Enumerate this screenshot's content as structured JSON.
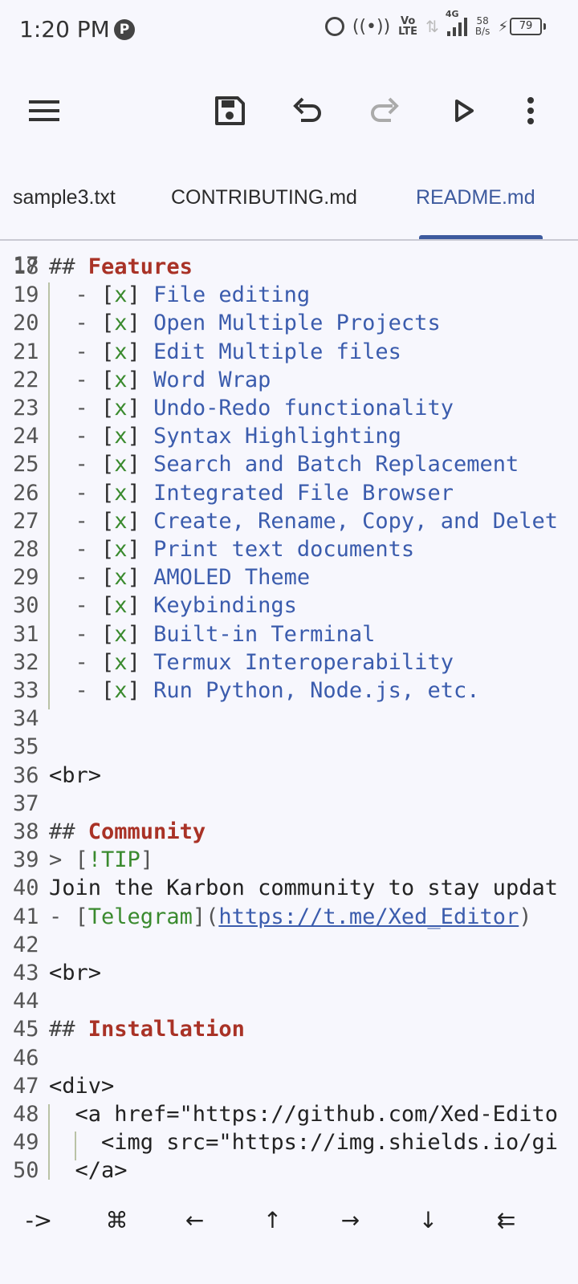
{
  "status": {
    "time": "1:20 PM",
    "p_badge": "P",
    "volte_top": "Vo",
    "volte_bottom": "LTE",
    "net_type": "4G",
    "speed_value": "58",
    "speed_unit": "B/s",
    "battery": "79",
    "icons": [
      "alarm-icon",
      "hotspot-icon",
      "volte-icon",
      "data-arrows-icon",
      "signal-icon",
      "charging-icon",
      "battery-icon"
    ]
  },
  "toolbar": {
    "icons": [
      "menu-icon",
      "save-icon",
      "undo-icon",
      "redo-icon",
      "run-icon",
      "more-icon"
    ]
  },
  "tabs": [
    {
      "label": "sample3.txt",
      "active": false
    },
    {
      "label": "CONTRIBUTING.md",
      "active": false
    },
    {
      "label": "README.md",
      "active": true
    }
  ],
  "editor": {
    "partial_top_line": "17",
    "lines": [
      {
        "n": "18",
        "hash": "##",
        "heading": "Features"
      },
      {
        "n": "19",
        "dash": "-",
        "box": "[x]",
        "text": "File editing"
      },
      {
        "n": "20",
        "dash": "-",
        "box": "[x]",
        "text": "Open Multiple Projects"
      },
      {
        "n": "21",
        "dash": "-",
        "box": "[x]",
        "text": "Edit Multiple files"
      },
      {
        "n": "22",
        "dash": "-",
        "box": "[x]",
        "text": "Word Wrap"
      },
      {
        "n": "23",
        "dash": "-",
        "box": "[x]",
        "text": "Undo-Redo functionality"
      },
      {
        "n": "24",
        "dash": "-",
        "box": "[x]",
        "text": "Syntax Highlighting"
      },
      {
        "n": "25",
        "dash": "-",
        "box": "[x]",
        "text": "Search and Batch Replacement"
      },
      {
        "n": "26",
        "dash": "-",
        "box": "[x]",
        "text": "Integrated File Browser"
      },
      {
        "n": "27",
        "dash": "-",
        "box": "[x]",
        "text": "Create, Rename, Copy, and Delet"
      },
      {
        "n": "28",
        "dash": "-",
        "box": "[x]",
        "text": "Print text documents"
      },
      {
        "n": "29",
        "dash": "-",
        "box": "[x]",
        "text": "AMOLED Theme"
      },
      {
        "n": "30",
        "dash": "-",
        "box": "[x]",
        "text": "Keybindings"
      },
      {
        "n": "31",
        "dash": "-",
        "box": "[x]",
        "text": "Built-in Terminal"
      },
      {
        "n": "32",
        "dash": "-",
        "box": "[x]",
        "text": "Termux Interoperability"
      },
      {
        "n": "33",
        "dash": "-",
        "box": "[x]",
        "text": "Run Python, Node.js, etc."
      },
      {
        "n": "34"
      },
      {
        "n": "35"
      },
      {
        "n": "36",
        "plain": "<br>"
      },
      {
        "n": "37"
      },
      {
        "n": "38",
        "hash": "##",
        "heading": "Community"
      },
      {
        "n": "39",
        "quote": "> [",
        "tip": "!TIP",
        "quote_end": "]"
      },
      {
        "n": "40",
        "plain": "Join the Karbon community to stay updat"
      },
      {
        "n": "41",
        "dash": "- [",
        "green": "Telegram",
        "mid": "](",
        "link": "https://t.me/Xed_Editor",
        "end": ")"
      },
      {
        "n": "42"
      },
      {
        "n": "43",
        "plain": "<br>"
      },
      {
        "n": "44"
      },
      {
        "n": "45",
        "hash": "##",
        "heading": "Installation"
      },
      {
        "n": "46"
      },
      {
        "n": "47",
        "plain": "<div>"
      },
      {
        "n": "48",
        "plain": "  <a href=\"https://github.com/Xed-Edito"
      },
      {
        "n": "49",
        "plain": "    <img src=\"https://img.shields.io/gi"
      },
      {
        "n": "50",
        "plain": "  </a>"
      }
    ]
  },
  "keys": [
    "->",
    "⌘",
    "←",
    "↑",
    "→",
    "↓",
    "⇇"
  ]
}
